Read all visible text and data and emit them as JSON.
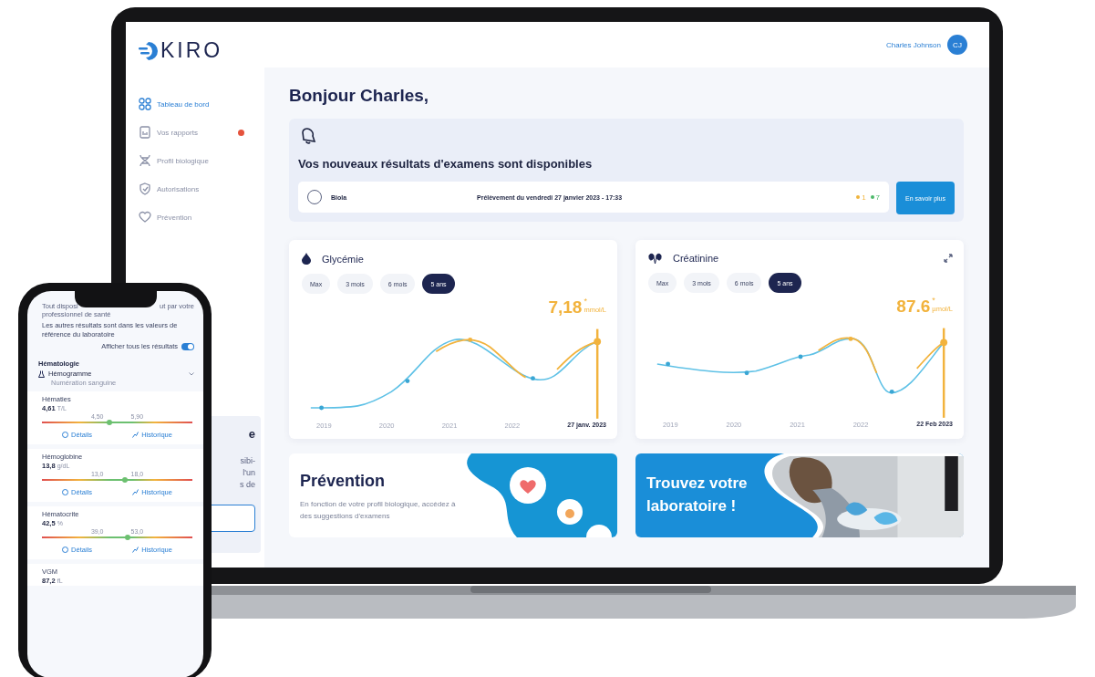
{
  "laptop": {
    "logo": "KIRO",
    "user": {
      "name": "Charles Johnson",
      "initials": "CJ"
    },
    "sidebar": {
      "items": [
        {
          "label": "Tableau de bord",
          "selected": true,
          "alert": false
        },
        {
          "label": "Vos rapports",
          "selected": false,
          "alert": true
        },
        {
          "label": "Profil biologique",
          "selected": false,
          "alert": false
        },
        {
          "label": "Autorisations",
          "selected": false,
          "alert": false
        },
        {
          "label": "Prévention",
          "selected": false,
          "alert": false
        }
      ],
      "card_fragments": [
        "e",
        "sibi-",
        "l'un",
        "s de"
      ]
    },
    "greeting": "Bonjour Charles,",
    "notification": {
      "title": "Vos nouveaux résultats d'examens sont disponibles",
      "checked": false,
      "lab": "Biola",
      "date": "Prélèvement du vendredi 27 janvier 2023 - 17:33",
      "counts": [
        {
          "value": "1",
          "color": "#f0b43c"
        },
        {
          "value": "7",
          "color": "#4cb96a"
        }
      ],
      "button": "En savoir plus"
    },
    "charts": [
      {
        "title": "Glycémie",
        "periods": [
          {
            "label": "Max",
            "selected": false
          },
          {
            "label": "3 mois",
            "selected": false
          },
          {
            "label": "6 mois",
            "selected": false
          },
          {
            "label": "5 ans",
            "selected": true
          }
        ],
        "value": "7,18",
        "mark": "*",
        "unit": "mmol/L",
        "years": [
          "2019",
          "2020",
          "2021",
          "2022"
        ],
        "last_date": "27 janv. 2023"
      },
      {
        "title": "Créatinine",
        "periods": [
          {
            "label": "Max",
            "selected": false
          },
          {
            "label": "3 mois",
            "selected": false
          },
          {
            "label": "6 mois",
            "selected": false
          },
          {
            "label": "5 ans",
            "selected": true
          }
        ],
        "value": "87.6",
        "mark": "*",
        "unit": "µmol/L",
        "years": [
          "2019",
          "2020",
          "2021",
          "2022"
        ],
        "last_date": "22 Feb 2023"
      }
    ],
    "promos": [
      {
        "kind": "prevention",
        "title": "Prévention",
        "text": "En fonction de votre profil biologique, accédez à des suggestions d'examens"
      },
      {
        "kind": "lab",
        "title": "Trouvez votre laboratoire !"
      }
    ]
  },
  "phone": {
    "intro": [
      "Tout disposi",
      "ut par votre",
      "professionnel de santé"
    ],
    "note": "Les autres résultats sont dans les valeurs de référence du laboratoire",
    "toggle": {
      "label": "Afficher tous les résultats",
      "on": true
    },
    "section": "Hématologie",
    "group": "Hémogramme",
    "subgroup": "Numération sanguine",
    "results": [
      {
        "name": "Hématies",
        "value": "4,61",
        "unit": "T/L",
        "low": "4,50",
        "high": "5,90",
        "level": 0.45,
        "actions": [
          "Détails",
          "Historique"
        ]
      },
      {
        "name": "Hémoglobine",
        "value": "13,8",
        "unit": "g/dL",
        "low": "13,0",
        "high": "18,0",
        "level": 0.55,
        "actions": [
          "Détails",
          "Historique"
        ]
      },
      {
        "name": "Hématocrite",
        "value": "42,5",
        "unit": "%",
        "low": "39,0",
        "high": "53,0",
        "level": 0.57,
        "actions": [
          "Détails",
          "Historique"
        ]
      },
      {
        "name": "VGM",
        "value": "87,2",
        "unit": "fL"
      }
    ]
  }
}
